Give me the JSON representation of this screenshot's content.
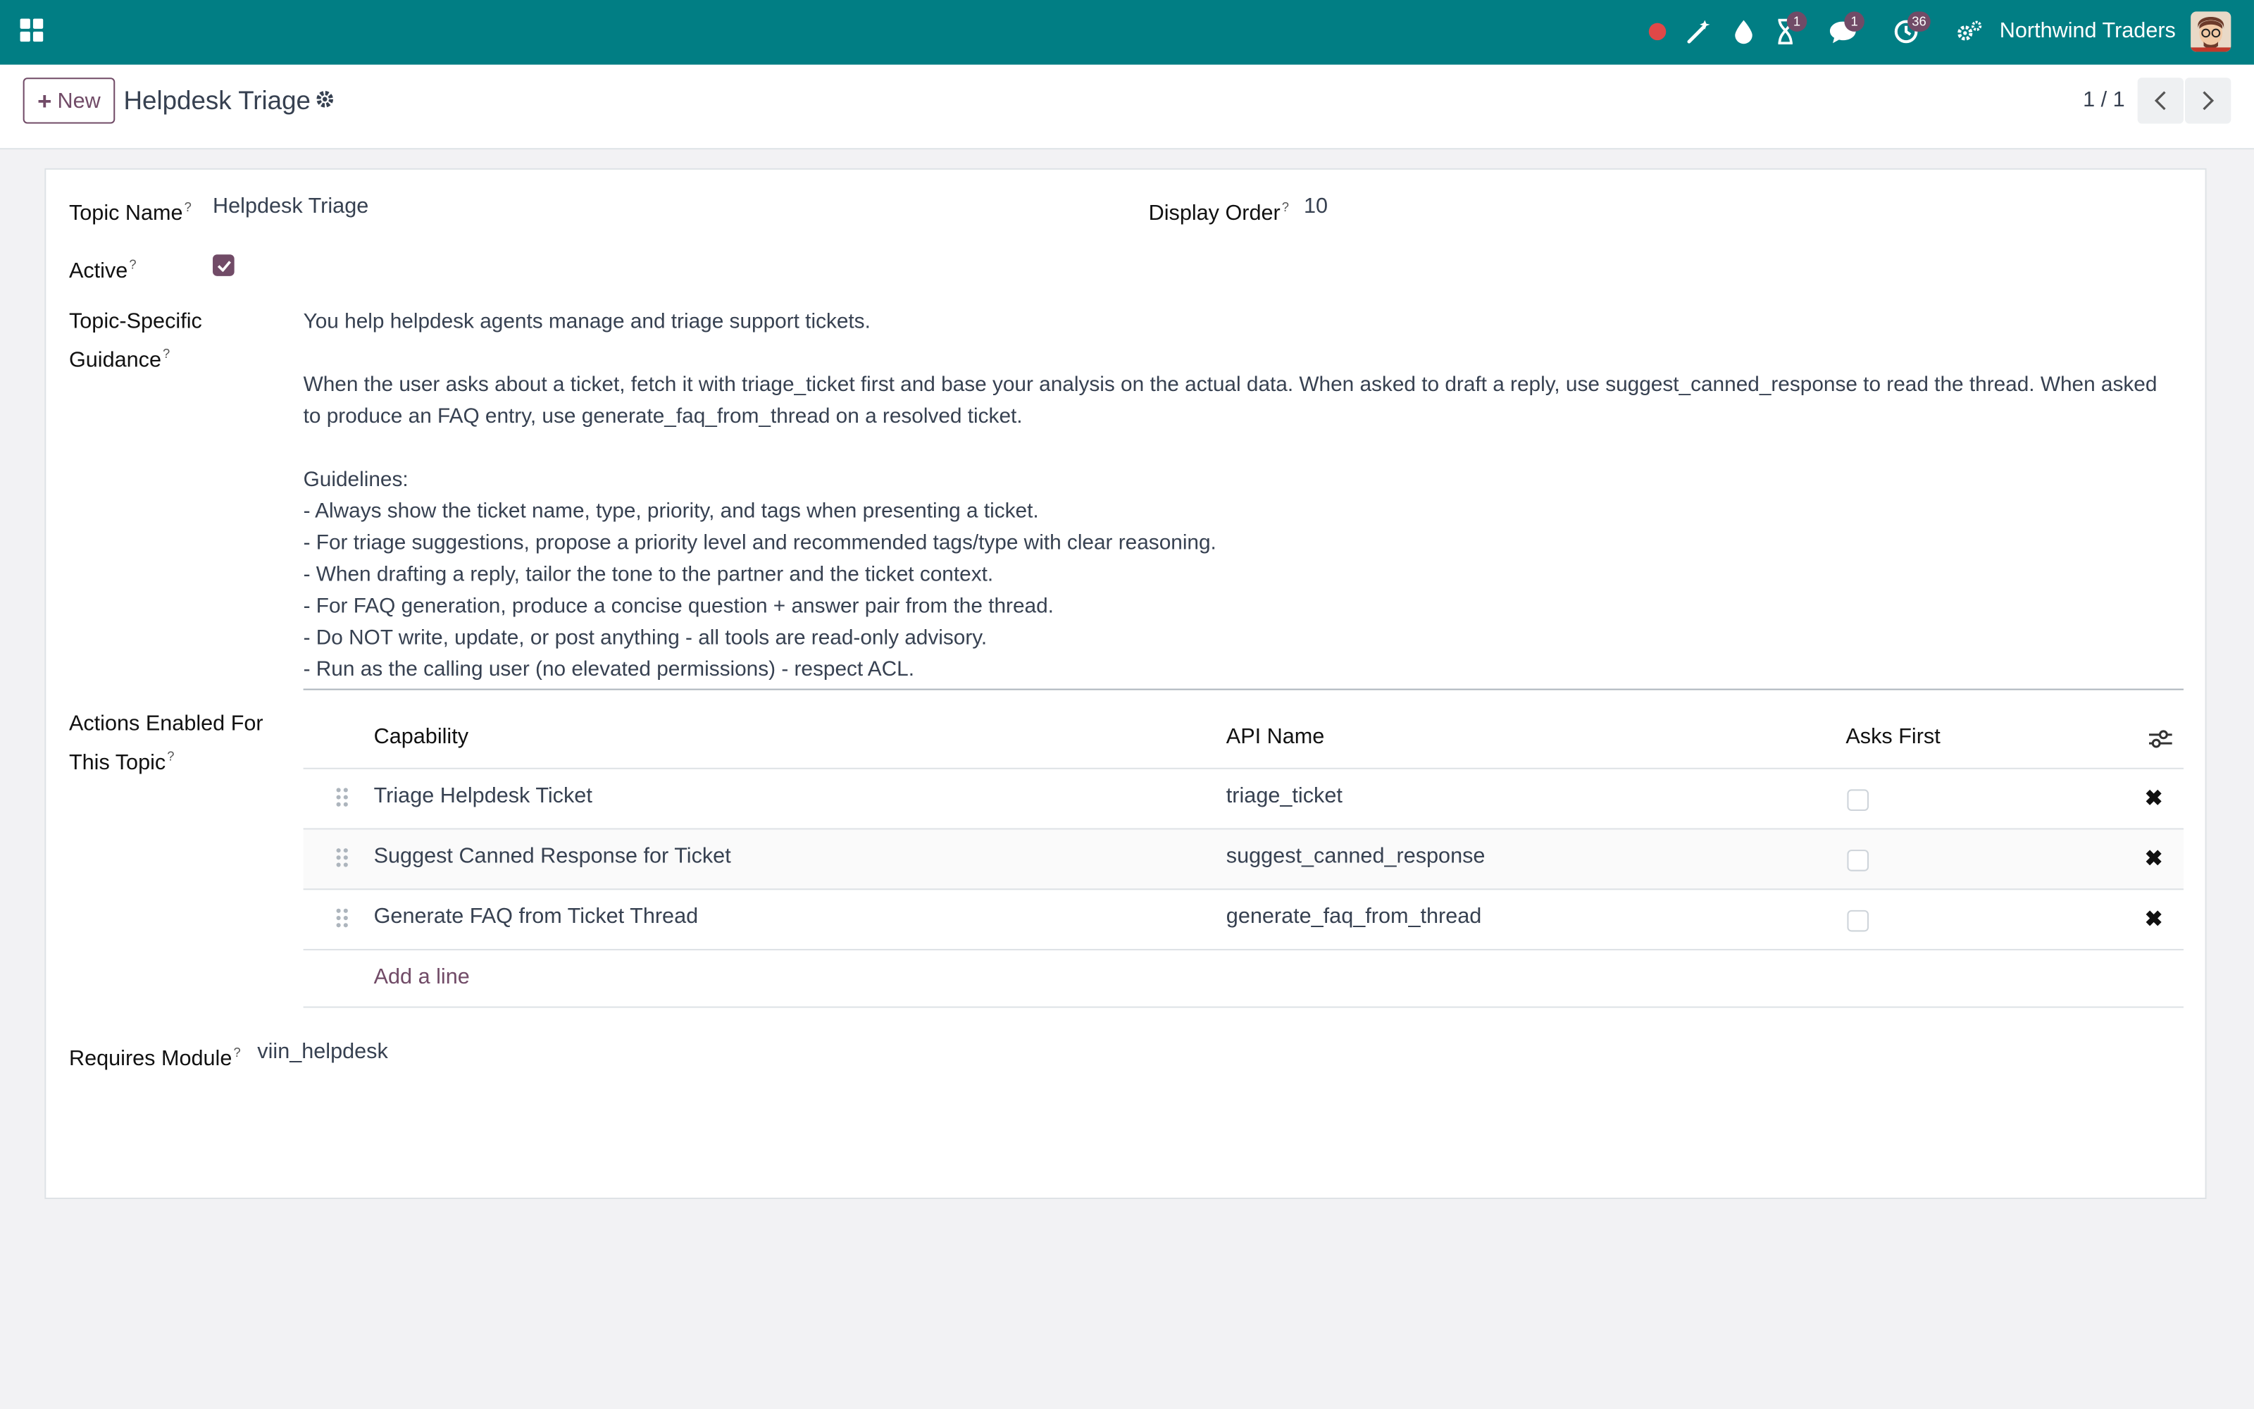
{
  "navbar": {
    "company": "Northwind Traders",
    "badges": {
      "activity": "1",
      "messages": "1",
      "timer": "36"
    },
    "brand_color": "#017e84"
  },
  "control_panel": {
    "new_label": "New",
    "title": "Helpdesk Triage",
    "pager": "1 / 1"
  },
  "form": {
    "topic_name_label": "Topic Name",
    "topic_name_value": "Helpdesk Triage",
    "display_order_label": "Display Order",
    "display_order_value": "10",
    "active_label": "Active",
    "active": true,
    "guidance_label_1": "Topic-Specific",
    "guidance_label_2": "Guidance",
    "guidance_lines": [
      "You help helpdesk agents manage and triage support tickets.",
      "",
      "When the user asks about a ticket, fetch it with triage_ticket first and base your analysis on the actual data. When asked to draft a reply, use suggest_canned_response to read the thread. When asked",
      "to produce an FAQ entry, use generate_faq_from_thread on a resolved ticket.",
      "",
      "Guidelines:",
      "- Always show the ticket name, type, priority, and tags when presenting a ticket.",
      "- For triage suggestions, propose a priority level and recommended tags/type with clear reasoning.",
      "- When drafting a reply, tailor the tone to the partner and the ticket context.",
      "- For FAQ generation, produce a concise question + answer pair from the thread.",
      "- Do NOT write, update, or post anything - all tools are read-only advisory.",
      "- Run as the calling user (no elevated permissions) - respect ACL."
    ],
    "actions_label_1": "Actions Enabled For",
    "actions_label_2": "This Topic",
    "requires_module_label": "Requires Module",
    "requires_module_value": "viin_helpdesk"
  },
  "actions_table": {
    "headers": {
      "capability": "Capability",
      "api_name": "API Name",
      "asks_first": "Asks First"
    },
    "rows": [
      {
        "capability": "Triage Helpdesk Ticket",
        "api_name": "triage_ticket",
        "asks_first": false
      },
      {
        "capability": "Suggest Canned Response for Ticket",
        "api_name": "suggest_canned_response",
        "asks_first": false
      },
      {
        "capability": "Generate FAQ from Ticket Thread",
        "api_name": "generate_faq_from_thread",
        "asks_first": false
      }
    ],
    "add_line": "Add a line",
    "delete_glyph": "✖"
  },
  "accent_color": "#714b67"
}
